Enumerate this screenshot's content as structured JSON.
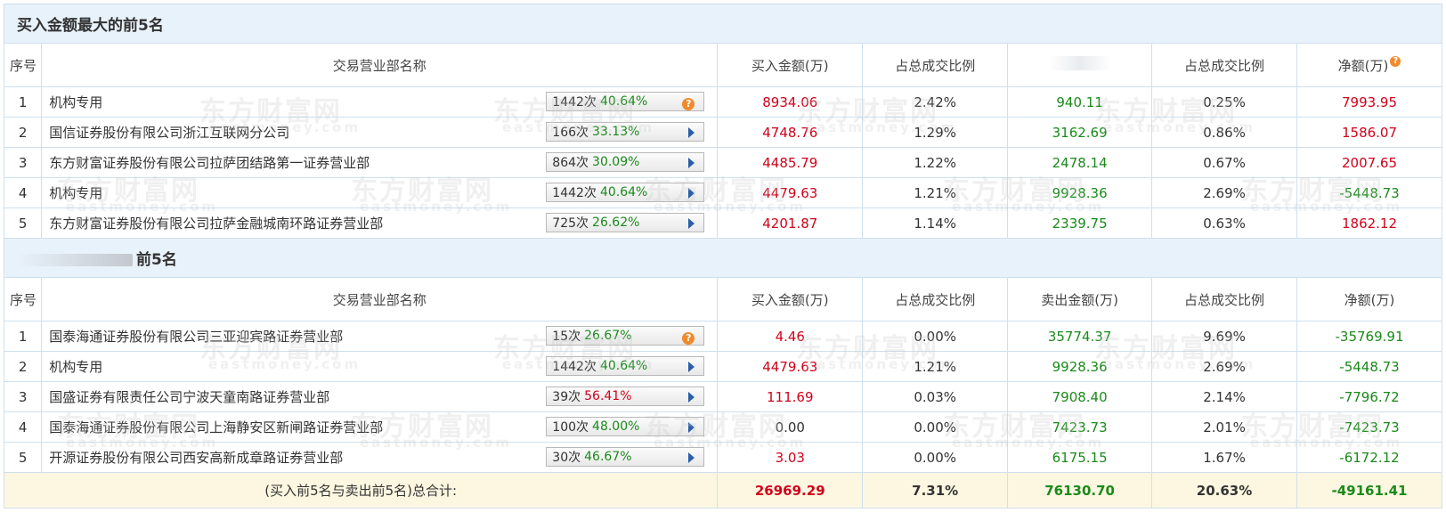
{
  "section1": {
    "title": "买入金额最大的前5名",
    "headers": [
      "序号",
      "交易营业部名称",
      "买入金额(万)",
      "占总成交比例",
      "",
      "占总成交比例",
      "净额(万)"
    ],
    "rows": [
      {
        "idx": "1",
        "name": "机构专用",
        "count": "1442次",
        "pct": "40.64%",
        "pct_color": "green",
        "icon": "help-icon",
        "buy": "8934.06",
        "buy_ratio": "2.42%",
        "sell": "940.11",
        "sell_ratio": "0.25%",
        "net": "7993.95",
        "net_color": "red"
      },
      {
        "idx": "2",
        "name": "国信证券股份有限公司浙江互联网分公司",
        "count": "166次",
        "pct": "33.13%",
        "pct_color": "green",
        "icon": "play-icon",
        "buy": "4748.76",
        "buy_ratio": "1.29%",
        "sell": "3162.69",
        "sell_ratio": "0.86%",
        "net": "1586.07",
        "net_color": "red"
      },
      {
        "idx": "3",
        "name": "东方财富证券股份有限公司拉萨团结路第一证券营业部",
        "count": "864次",
        "pct": "30.09%",
        "pct_color": "green",
        "icon": "play-icon",
        "buy": "4485.79",
        "buy_ratio": "1.22%",
        "sell": "2478.14",
        "sell_ratio": "0.67%",
        "net": "2007.65",
        "net_color": "red"
      },
      {
        "idx": "4",
        "name": "机构专用",
        "count": "1442次",
        "pct": "40.64%",
        "pct_color": "green",
        "icon": "play-icon",
        "buy": "4479.63",
        "buy_ratio": "1.21%",
        "sell": "9928.36",
        "sell_ratio": "2.69%",
        "net": "-5448.73",
        "net_color": "green"
      },
      {
        "idx": "5",
        "name": "东方财富证券股份有限公司拉萨金融城南环路证券营业部",
        "count": "725次",
        "pct": "26.62%",
        "pct_color": "green",
        "icon": "play-icon",
        "buy": "4201.87",
        "buy_ratio": "1.14%",
        "sell": "2339.75",
        "sell_ratio": "0.63%",
        "net": "1862.12",
        "net_color": "red"
      }
    ]
  },
  "section2": {
    "title": "前5名",
    "headers": [
      "序号",
      "交易营业部名称",
      "买入金额(万)",
      "占总成交比例",
      "卖出金额(万)",
      "占总成交比例",
      "净额(万)"
    ],
    "rows": [
      {
        "idx": "1",
        "name": "国泰海通证券股份有限公司三亚迎宾路证券营业部",
        "count": "15次",
        "pct": "26.67%",
        "pct_color": "green",
        "icon": "help-icon",
        "buy": "4.46",
        "buy_color": "red",
        "buy_ratio": "0.00%",
        "sell": "35774.37",
        "sell_ratio": "9.69%",
        "net": "-35769.91",
        "net_color": "green"
      },
      {
        "idx": "2",
        "name": "机构专用",
        "count": "1442次",
        "pct": "40.64%",
        "pct_color": "green",
        "icon": "play-icon",
        "buy": "4479.63",
        "buy_color": "red",
        "buy_ratio": "1.21%",
        "sell": "9928.36",
        "sell_ratio": "2.69%",
        "net": "-5448.73",
        "net_color": "green"
      },
      {
        "idx": "3",
        "name": "国盛证券有限责任公司宁波天童南路证券营业部",
        "count": "39次",
        "pct": "56.41%",
        "pct_color": "red",
        "icon": "play-icon",
        "buy": "111.69",
        "buy_color": "red",
        "buy_ratio": "0.03%",
        "sell": "7908.40",
        "sell_ratio": "2.14%",
        "net": "-7796.72",
        "net_color": "green"
      },
      {
        "idx": "4",
        "name": "国泰海通证券股份有限公司上海静安区新闸路证券营业部",
        "count": "100次",
        "pct": "48.00%",
        "pct_color": "green",
        "icon": "play-icon",
        "buy": "0.00",
        "buy_color": "dark",
        "buy_ratio": "0.00%",
        "sell": "7423.73",
        "sell_ratio": "2.01%",
        "net": "-7423.73",
        "net_color": "green"
      },
      {
        "idx": "5",
        "name": "开源证券股份有限公司西安高新成章路证券营业部",
        "count": "30次",
        "pct": "46.67%",
        "pct_color": "green",
        "icon": "play-icon",
        "buy": "3.03",
        "buy_color": "red",
        "buy_ratio": "0.00%",
        "sell": "6175.15",
        "sell_ratio": "1.67%",
        "net": "-6172.12",
        "net_color": "green"
      }
    ]
  },
  "summary": {
    "label": "(买入前5名与卖出前5名)总合计:",
    "buy": "26969.29",
    "buy_ratio": "7.31%",
    "sell": "76130.70",
    "sell_ratio": "20.63%",
    "net": "-49161.41"
  },
  "watermark": {
    "cn": "东方财富网",
    "en": "eastmoney.com"
  },
  "colors": {
    "red": "#d0021b",
    "green": "#1a8a1a",
    "header_bg": "#e8f2fb",
    "summary_bg": "#fdf7e1",
    "border": "#cfe0ee"
  }
}
